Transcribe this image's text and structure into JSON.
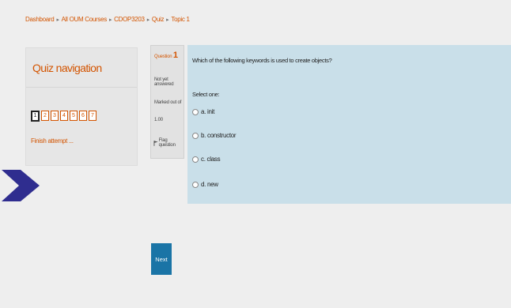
{
  "breadcrumb": {
    "items": [
      "Dashboard",
      "All OUM Courses",
      "CDOP3203",
      "Quiz",
      "Topic 1"
    ],
    "separator": "▸"
  },
  "quiz_nav": {
    "title": "Quiz navigation",
    "buttons": [
      "1",
      "2",
      "3",
      "4",
      "5",
      "6",
      "7"
    ],
    "current": "1",
    "finish_label": "Finish attempt ..."
  },
  "question_info": {
    "label": "Question",
    "number": "1",
    "state": "Not yet answered",
    "marked_line1": "Marked out of",
    "marked_line2": "1.00",
    "flag_label": "Flag question"
  },
  "question": {
    "text": "Which of the following keywords is used to create objects?",
    "prompt": "Select one:",
    "options": [
      "a. init",
      "b. constructor",
      "c. class",
      "d. new"
    ]
  },
  "next_label": "Next",
  "colors": {
    "accent": "#d35400",
    "question_bg": "#c9dfe9",
    "button_bg": "#1a74a6",
    "arrow": "#2f2d8f"
  },
  "icons": {
    "arrow": "chevron-arrow-icon",
    "flag": "flag-icon",
    "radio": "radio-button-icon"
  }
}
